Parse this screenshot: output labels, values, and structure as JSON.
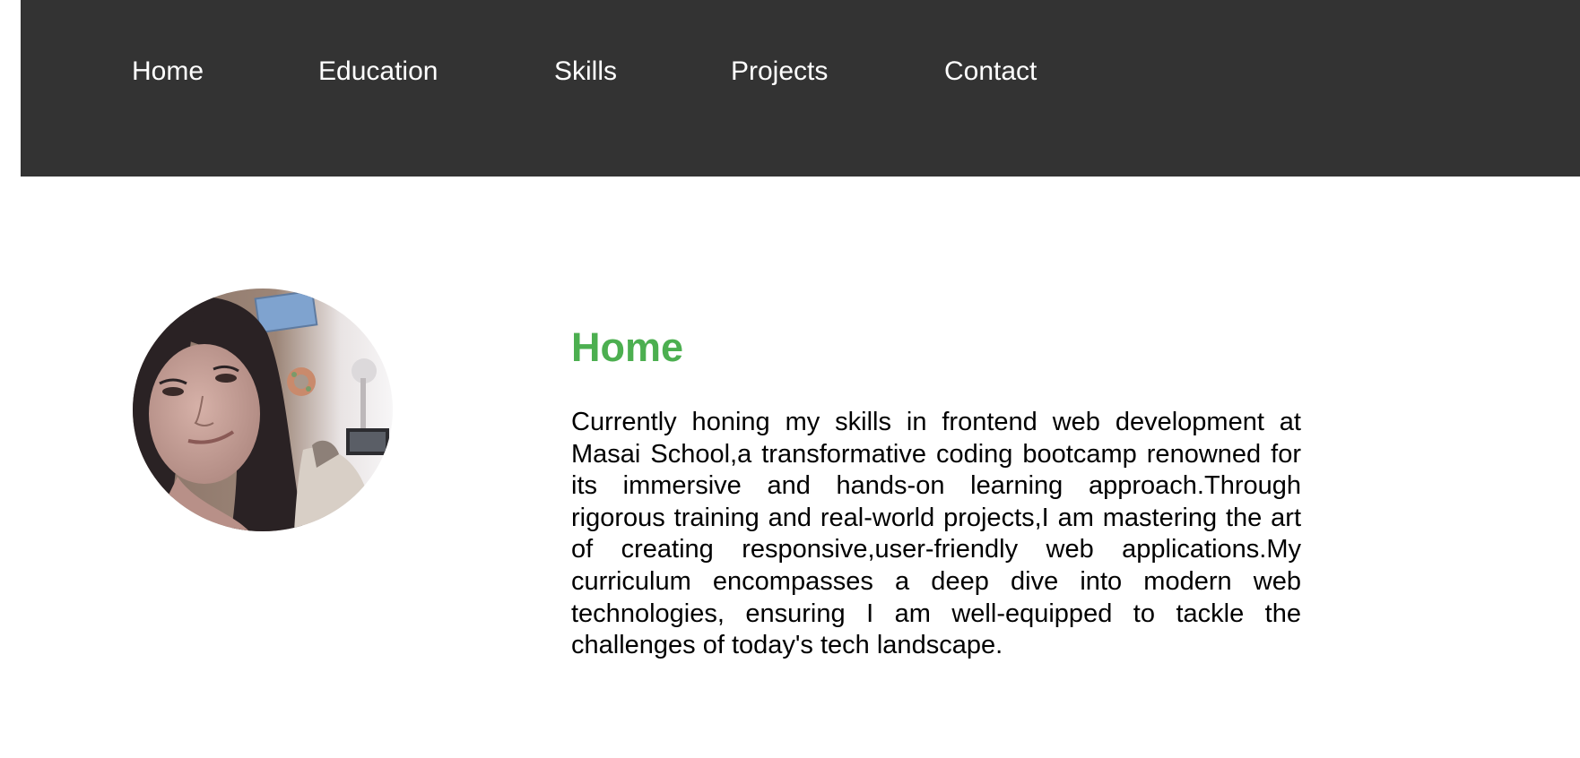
{
  "nav": {
    "items": [
      {
        "label": "Home"
      },
      {
        "label": "Education"
      },
      {
        "label": "Skills"
      },
      {
        "label": "Projects"
      },
      {
        "label": "Contact"
      }
    ]
  },
  "home": {
    "title": "Home",
    "description": "Currently honing my skills in frontend web development at Masai School,a transformative coding bootcamp renowned for its immersive and hands-on learning approach.Through rigorous training and real-world projects,I am mastering the art of creating responsive,user-friendly web applications.My curriculum encompasses a deep dive into modern web technologies, ensuring I am well-equipped to tackle the challenges of today's tech landscape."
  },
  "colors": {
    "navbar_bg": "#333333",
    "nav_text": "#ffffff",
    "heading_accent": "#4caf50",
    "body_text": "#000000"
  }
}
